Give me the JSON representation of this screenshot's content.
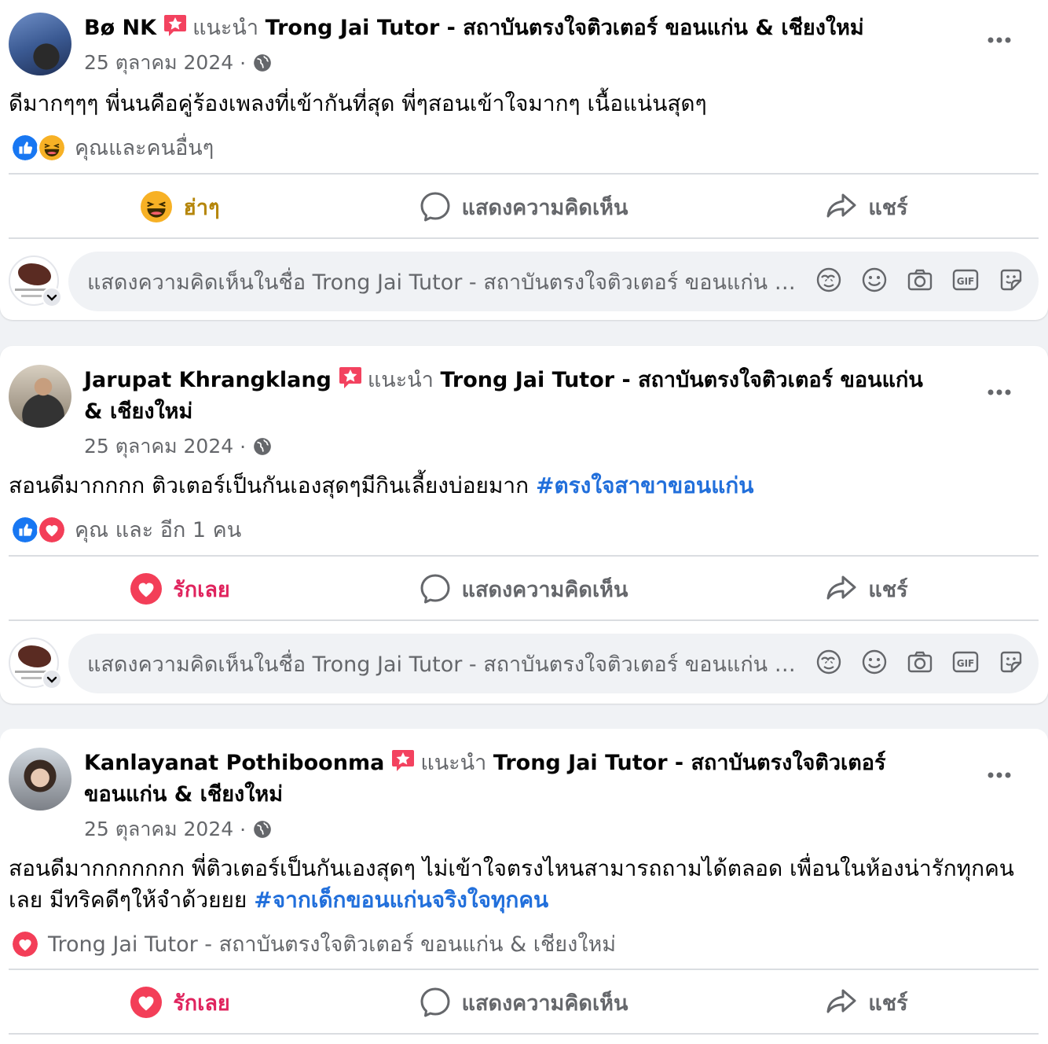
{
  "posts": [
    {
      "author": "Bø NK",
      "recommend_label": "แนะนำ",
      "page_name": "Trong Jai Tutor - สถาบันตรงใจติวเตอร์ ขอนแก่น & เชียงใหม่",
      "date": "25 ตุลาคม 2024",
      "separator": "·",
      "text": "ดีมากๆๆๆ พี่นนคือคู่ร้องเพลงที่เข้ากันที่สุด พี่ๆสอนเข้าใจมากๆ เนื้อแน่นสุดๆ",
      "hashtag": "",
      "reactions_text": "คุณและคนอื่นๆ",
      "reaction_icons": [
        "like-icon",
        "haha-icon"
      ],
      "my_reaction_label": "ฮ่าๆ",
      "comment_label": "แสดงความคิดเห็น",
      "share_label": "แชร์",
      "comment_placeholder": "แสดงความคิดเห็นในชื่อ Trong Jai Tutor - สถาบันตรงใจติวเตอร์ ขอนแก่น & เชียงใหม่"
    },
    {
      "author": "Jarupat Khrangklang",
      "recommend_label": "แนะนำ",
      "page_name": "Trong Jai Tutor - สถาบันตรงใจติวเตอร์ ขอนแก่น & เชียงใหม่",
      "date": "25 ตุลาคม 2024",
      "separator": "·",
      "text": "สอนดีมากกกก ติวเตอร์เป็นกันเองสุดๆมีกินเลี้ยงบ่อยมาก ",
      "hashtag": "#ตรงใจสาขาขอนแก่น",
      "reactions_text": "คุณ และ อีก 1 คน",
      "reaction_icons": [
        "like-icon",
        "love-icon"
      ],
      "my_reaction_label": "รักเลย",
      "comment_label": "แสดงความคิดเห็น",
      "share_label": "แชร์",
      "comment_placeholder": "แสดงความคิดเห็นในชื่อ Trong Jai Tutor - สถาบันตรงใจติวเตอร์ ขอนแก่น & เชียงใหม่"
    },
    {
      "author": "Kanlayanat Pothiboonma",
      "recommend_label": "แนะนำ",
      "page_name": "Trong Jai Tutor - สถาบันตรงใจติวเตอร์ ขอนแก่น & เชียงใหม่",
      "date": "25 ตุลาคม 2024",
      "separator": "·",
      "text": "สอนดีมากกกกกกก พี่ติวเตอร์เป็นกันเองสุดๆ ไม่เข้าใจตรงไหนสามารถถามได้ตลอด เพื่อนในห้องน่ารักทุกคนเลย มีทริคดีๆให้จำด้วยยย ",
      "hashtag": "#จากเด็กขอนแก่นจริงใจทุกคน",
      "reactions_text": "Trong Jai Tutor - สถาบันตรงใจติวเตอร์ ขอนแก่น & เชียงใหม่",
      "reaction_icons": [
        "love-icon"
      ],
      "my_reaction_label": "รักเลย",
      "comment_label": "แสดงความคิดเห็น",
      "share_label": "แชร์"
    }
  ],
  "colors": {
    "like": "#1877f2",
    "love": "#f33e58",
    "haha": "#f7b125",
    "hashtag": "#216fdb",
    "muted": "#65676b"
  }
}
